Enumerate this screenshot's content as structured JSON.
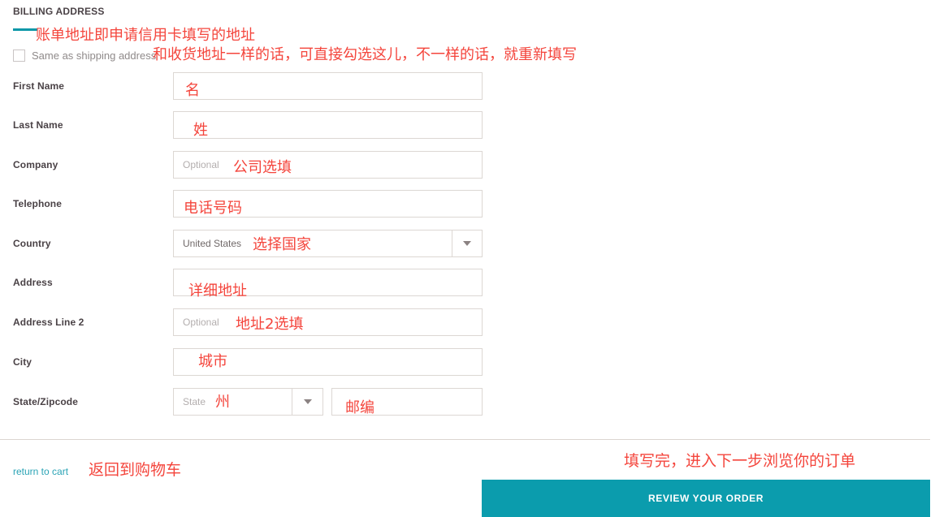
{
  "page": {
    "heading": "BILLING ADDRESS"
  },
  "same_as_shipping": {
    "label": "Same as shipping address",
    "checked": false
  },
  "form": {
    "fields": [
      {
        "label": "First Name",
        "placeholder": "",
        "value": ""
      },
      {
        "label": "Last Name",
        "placeholder": "",
        "value": ""
      },
      {
        "label": "Company",
        "placeholder": "Optional",
        "value": ""
      },
      {
        "label": "Telephone",
        "placeholder": "",
        "value": ""
      },
      {
        "label": "Country",
        "placeholder": "",
        "value": "United States"
      },
      {
        "label": "Address",
        "placeholder": "",
        "value": ""
      },
      {
        "label": "Address Line 2",
        "placeholder": "Optional",
        "value": ""
      },
      {
        "label": "City",
        "placeholder": "",
        "value": ""
      },
      {
        "label": "State/Zipcode",
        "placeholder": "State",
        "value": ""
      }
    ],
    "state_placeholder": "State",
    "zipcode_value": ""
  },
  "footer": {
    "return_link": "return to cart",
    "review_button": "REVIEW YOUR ORDER"
  },
  "annotations": {
    "billing_note": "账单地址即申请信用卡填写的地址",
    "same_as_shipping_note": "和收货地址一样的话，可直接勾选这儿，不一样的话，就重新填写",
    "first_name": "名",
    "last_name": "姓",
    "company": "公司选填",
    "telephone": "电话号码",
    "country": "选择国家",
    "address": "详细地址",
    "address2": "地址2选填",
    "city": "城市",
    "state": "州",
    "zipcode": "邮编",
    "return_cart": "返回到购物车",
    "review_order": "填写完，进入下一步浏览你的订单"
  },
  "colors": {
    "accent_teal": "#0b9cad",
    "annotation_red": "#f4453c",
    "link_teal": "#2aa3b5",
    "label_gray": "#4a4246",
    "border_gray": "#dcd7d3"
  }
}
